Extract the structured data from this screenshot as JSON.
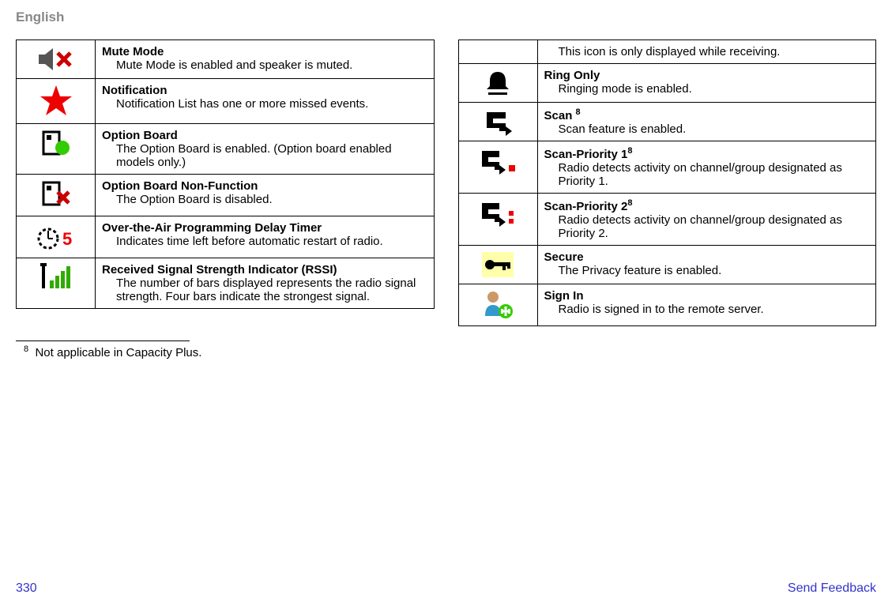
{
  "header": "English",
  "left": [
    {
      "title": "Mute Mode",
      "desc": "Mute Mode is enabled and speaker is muted."
    },
    {
      "title": "Notification",
      "desc": "Notification List has one or more missed events."
    },
    {
      "title": "Option Board",
      "desc": "The Option Board is enabled. (Option board enabled models only.)"
    },
    {
      "title": "Option Board Non-Function",
      "desc": "The Option Board is disabled."
    },
    {
      "title": "Over-the-Air Programming Delay Timer",
      "desc": "Indicates time left before automatic restart of radio."
    },
    {
      "title": "Received Signal Strength Indicator (RSSI)",
      "desc": "The number of bars displayed represents the radio signal strength. Four bars indicate the strongest signal."
    }
  ],
  "right": [
    {
      "title": "",
      "desc": "This icon is only displayed while receiving."
    },
    {
      "title": "Ring Only",
      "desc": "Ringing mode is enabled."
    },
    {
      "title": "Scan ",
      "sup": "8",
      "desc": "Scan feature is enabled."
    },
    {
      "title": "Scan-Priority 1",
      "sup": "8",
      "desc": "Radio detects activity on channel/group designated as Priority 1."
    },
    {
      "title": "Scan-Priority 2",
      "sup": "8",
      "desc": "Radio detects activity on channel/group designated as Priority 2."
    },
    {
      "title": "Secure",
      "desc": "The Privacy feature is enabled."
    },
    {
      "title": "Sign In",
      "desc": "Radio is signed in to the remote server."
    }
  ],
  "footnote_num": "8",
  "footnote_text": "Not applicable in Capacity Plus.",
  "page_number": "330",
  "feedback": "Send Feedback"
}
